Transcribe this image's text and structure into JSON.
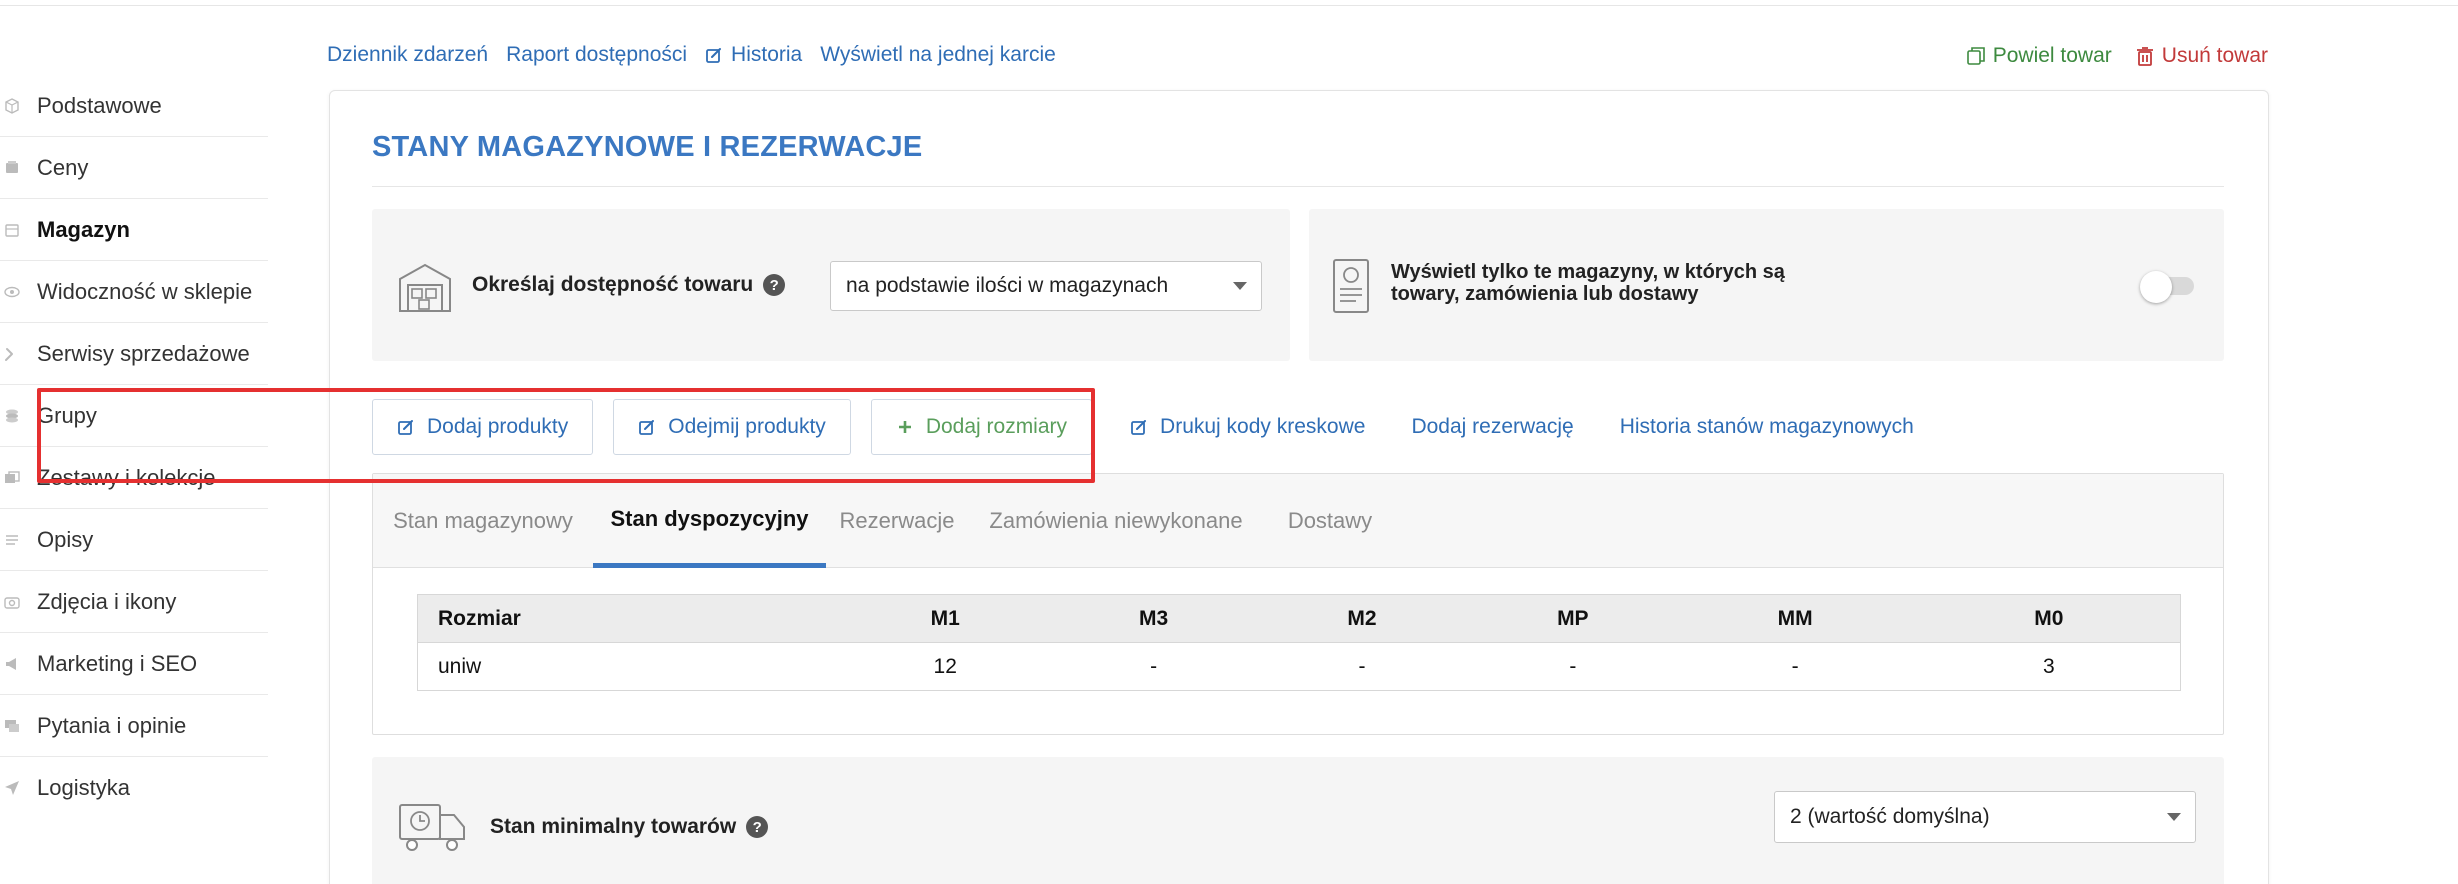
{
  "sidebar": {
    "items": [
      {
        "label": "Podstawowe",
        "icon": "box-icon",
        "active": false
      },
      {
        "label": "Ceny",
        "icon": "price-tag-icon",
        "active": false
      },
      {
        "label": "Magazyn",
        "icon": "warehouse-icon",
        "active": true
      },
      {
        "label": "Widoczność w sklepie",
        "icon": "eye-icon",
        "active": false
      },
      {
        "label": "Serwisy sprzedażowe",
        "icon": "gavel-icon",
        "active": false
      },
      {
        "label": "Grupy",
        "icon": "stack-icon",
        "active": false
      },
      {
        "label": "Zestawy i kolekcje",
        "icon": "collection-icon",
        "active": false
      },
      {
        "label": "Opisy",
        "icon": "text-lines-icon",
        "active": false
      },
      {
        "label": "Zdjęcia i ikony",
        "icon": "camera-icon",
        "active": false
      },
      {
        "label": "Marketing i SEO",
        "icon": "megaphone-icon",
        "active": false
      },
      {
        "label": "Pytania i opinie",
        "icon": "chat-icon",
        "active": false
      },
      {
        "label": "Logistyka",
        "icon": "send-icon",
        "active": false
      }
    ]
  },
  "toplinks": {
    "log": "Dziennik zdarzeń",
    "report": "Raport dostępności",
    "history": "Historia",
    "single_card": "Wyświetl na jednej karcie"
  },
  "actions": {
    "duplicate": "Powiel towar",
    "delete": "Usuń towar"
  },
  "card": {
    "title": "STANY MAGAZYNOWE I REZERWACJE",
    "availability": {
      "label": "Określaj dostępność towaru",
      "selected": "na podstawie ilości w magazynach"
    },
    "filter": {
      "label": "Wyświetl tylko te magazyny, w których są towary, zamówienia lub dostawy",
      "enabled": false
    },
    "buttons": {
      "add_products": "Dodaj produkty",
      "subtract_products": "Odejmij produkty",
      "add_sizes": "Dodaj rozmiary",
      "print_barcodes": "Drukuj kody kreskowe",
      "add_reservation": "Dodaj rezerwację",
      "stock_history": "Historia stanów magazynowych"
    },
    "tabs": [
      {
        "label": "Stan magazynowy",
        "active": false
      },
      {
        "label": "Stan dyspozycyjny",
        "active": true
      },
      {
        "label": "Rezerwacje",
        "active": false
      },
      {
        "label": "Zamówienia niewykonane",
        "active": false
      },
      {
        "label": "Dostawy",
        "active": false
      }
    ],
    "table": {
      "headers": [
        "Rozmiar",
        "M1",
        "M3",
        "M2",
        "MP",
        "MM",
        "M0"
      ],
      "rows": [
        [
          "uniw",
          "12",
          "-",
          "-",
          "-",
          "-",
          "3"
        ]
      ]
    },
    "min_stock": {
      "label": "Stan minimalny towarów",
      "selected": "2 (wartość domyślna)"
    }
  },
  "colors": {
    "link": "#2f6db5",
    "title": "#3b78c2",
    "highlight": "#e53030",
    "duplicate": "#3d8a3f",
    "delete": "#c23a3a"
  }
}
